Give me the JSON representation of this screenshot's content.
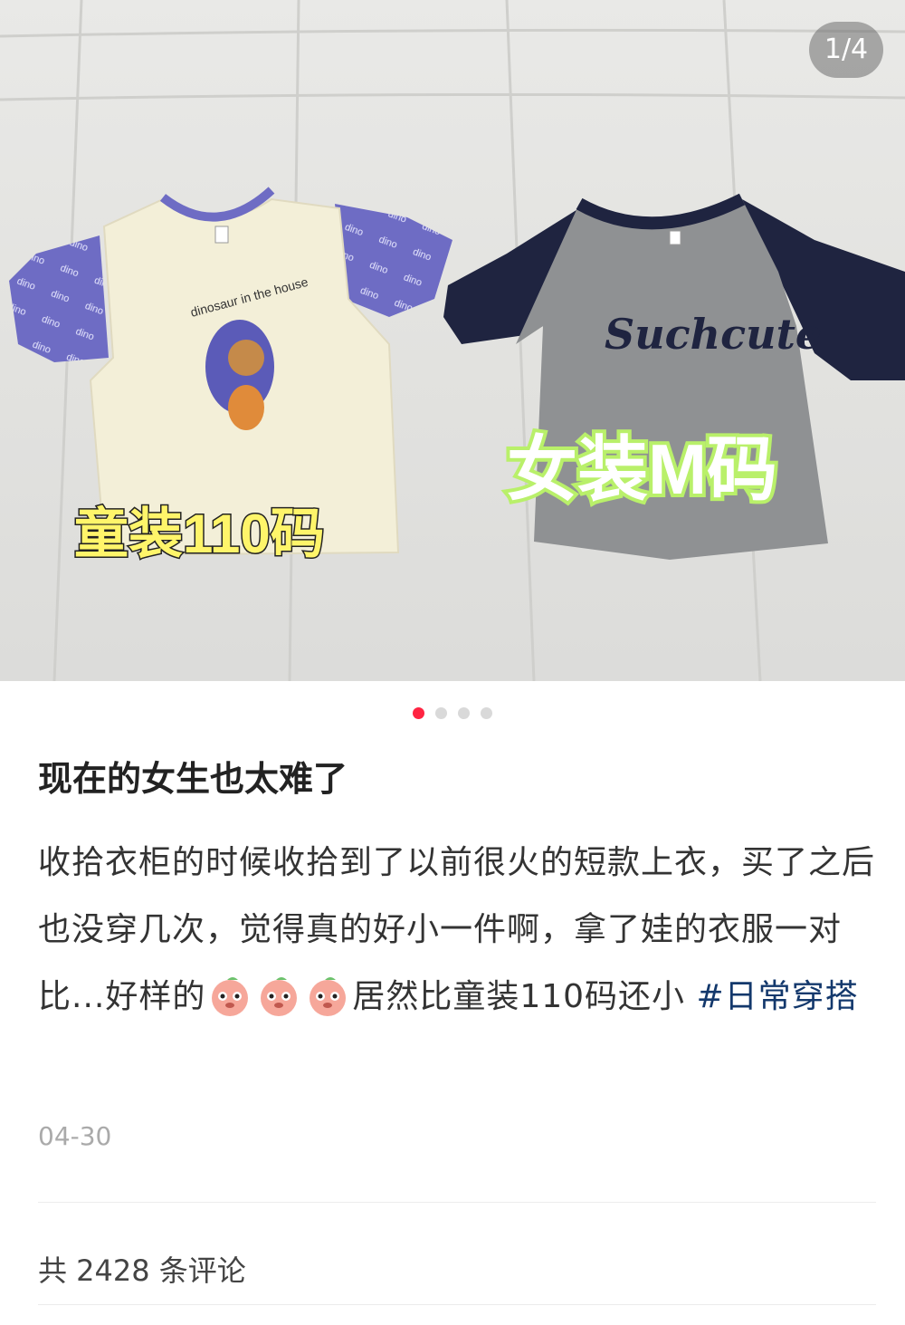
{
  "gallery": {
    "counter": "1/4",
    "caption_left": "童装110码",
    "caption_right": "女装M码",
    "shirt_left_print": "dinosaur in the house",
    "shirt_left_sleeve_print": "dino",
    "shirt_right_print": "Suchcute",
    "page_count": 4,
    "active_page": 1
  },
  "post": {
    "title": "现在的女生也太难了",
    "body_part1": "收拾衣柜的时候收拾到了以前很火的短款上衣，买了之后也没穿几次，觉得真的好小一件啊，拿了娃的衣服一对比...好样的",
    "body_part2": "居然比童装110码还小",
    "hashtag": "#日常穿搭",
    "emoji_name": "peach-face-emoji",
    "date": "04-30"
  },
  "comments": {
    "summary": "共 2428 条评论"
  },
  "colors": {
    "accent": "#ff2442",
    "hashtag": "#13386c",
    "caption_yellow": "#fff56a",
    "caption_green": "#b9f06a"
  }
}
